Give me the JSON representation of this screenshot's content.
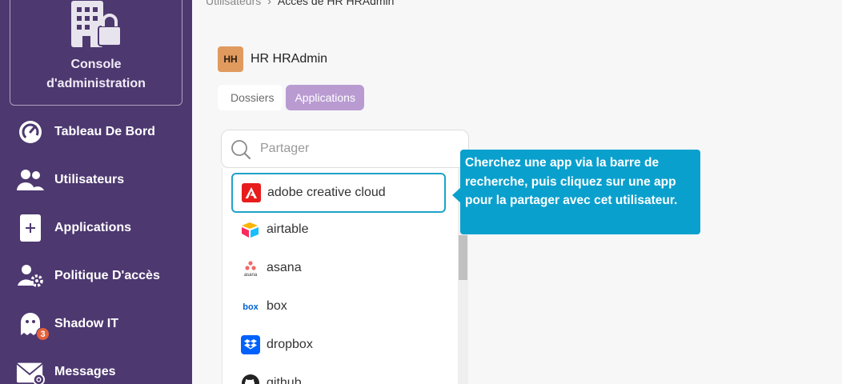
{
  "sidebar": {
    "console_title_line1": "Console",
    "console_title_line2": "d'administration",
    "items": [
      {
        "label": "Tableau De Bord",
        "icon": "gauge-icon"
      },
      {
        "label": "Utilisateurs",
        "icon": "users-icon"
      },
      {
        "label": "Applications",
        "icon": "plus-icon"
      },
      {
        "label": "Politique D'accès",
        "icon": "user-gear-icon"
      },
      {
        "label": "Shadow IT",
        "icon": "ghost-icon",
        "badge": "3"
      },
      {
        "label": "Messages",
        "icon": "envelope-icon"
      }
    ]
  },
  "breadcrumb": {
    "parent": "Utilisateurs",
    "separator": "›",
    "current": "Accès de HR HRAdmin"
  },
  "user": {
    "initials": "HH",
    "name": "HR HRAdmin"
  },
  "tabs": [
    {
      "label": "Dossiers",
      "active": false
    },
    {
      "label": "Applications",
      "active": true
    }
  ],
  "search": {
    "placeholder": "Partager",
    "value": ""
  },
  "apps": [
    {
      "name": "adobe creative cloud",
      "icon": "adobe-logo-icon",
      "highlighted": true
    },
    {
      "name": "airtable",
      "icon": "airtable-logo-icon"
    },
    {
      "name": "asana",
      "icon": "asana-logo-icon"
    },
    {
      "name": "box",
      "icon": "box-logo-icon"
    },
    {
      "name": "dropbox",
      "icon": "dropbox-logo-icon"
    },
    {
      "name": "github",
      "icon": "github-logo-icon"
    }
  ],
  "logo_texts": {
    "asana": "asana",
    "box": "box"
  },
  "tooltip": {
    "text": "Cherchez une app via la barre de recherche, puis cliquez sur une app pour la partager avec cet utilisateur."
  },
  "colors": {
    "sidebar": "#4d3870",
    "accent_tab": "#b99bd2",
    "tooltip": "#0aa0cd",
    "badge": "#e4613a",
    "avatar": "#e09a5e"
  }
}
